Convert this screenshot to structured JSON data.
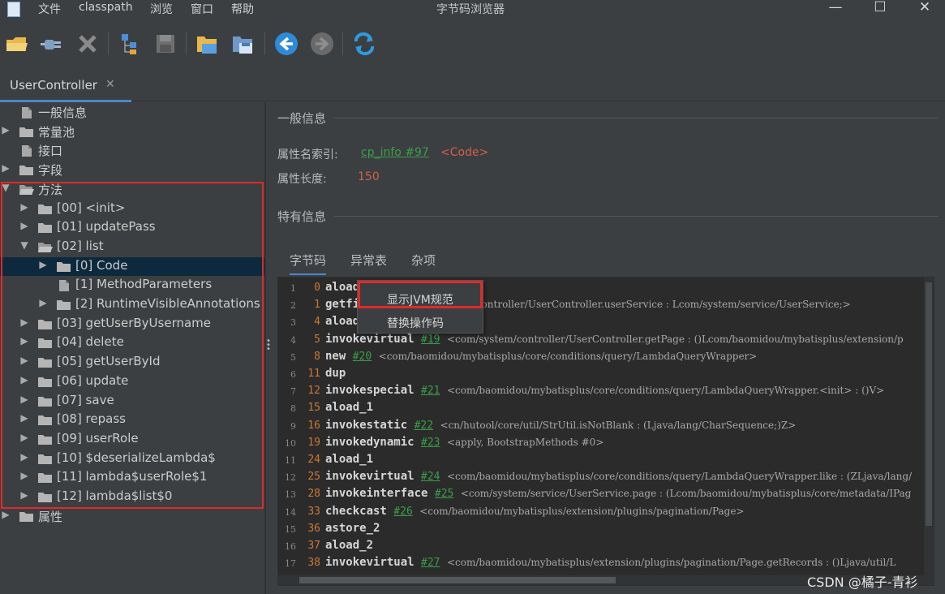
{
  "menu": [
    "文件",
    "classpath",
    "浏览",
    "窗口",
    "帮助"
  ],
  "window_title": "字节码浏览器",
  "window_controls": [
    "minimize-icon",
    "maximize-icon",
    "close-icon"
  ],
  "toolbar_icons": [
    "open-folder-icon",
    "plug-icon",
    "close-x-icon",
    "tree-icon",
    "save-icon",
    "folder-open-icon",
    "save-as-icon",
    "back-arrow-icon",
    "forward-arrow-icon",
    "refresh-icon"
  ],
  "tab": {
    "label": "UserController",
    "close": "✕"
  },
  "tree": [
    {
      "label": "一般信息",
      "arrow": "",
      "icon": "file"
    },
    {
      "label": "常量池",
      "arrow": "▶",
      "icon": "folder"
    },
    {
      "label": "接口",
      "arrow": "",
      "icon": "file"
    },
    {
      "label": "字段",
      "arrow": "▶",
      "icon": "folder"
    },
    {
      "label": "方法",
      "arrow": "▼",
      "icon": "folder-open"
    },
    {
      "label": "[00] <init>",
      "arrow": "▶",
      "icon": "folder"
    },
    {
      "label": "[01] updatePass",
      "arrow": "▶",
      "icon": "folder"
    },
    {
      "label": "[02] list",
      "arrow": "▼",
      "icon": "folder-open"
    },
    {
      "label": "[0] Code",
      "arrow": "▶",
      "icon": "folder"
    },
    {
      "label": "[1] MethodParameters",
      "arrow": "",
      "icon": "file"
    },
    {
      "label": "[2] RuntimeVisibleAnnotations",
      "arrow": "▶",
      "icon": "folder"
    },
    {
      "label": "[03] getUserByUsername",
      "arrow": "▶",
      "icon": "folder"
    },
    {
      "label": "[04] delete",
      "arrow": "▶",
      "icon": "folder"
    },
    {
      "label": "[05] getUserById",
      "arrow": "▶",
      "icon": "folder"
    },
    {
      "label": "[06] update",
      "arrow": "▶",
      "icon": "folder"
    },
    {
      "label": "[07] save",
      "arrow": "▶",
      "icon": "folder"
    },
    {
      "label": "[08] repass",
      "arrow": "▶",
      "icon": "folder"
    },
    {
      "label": "[09] userRole",
      "arrow": "▶",
      "icon": "folder"
    },
    {
      "label": "[10] $deserializeLambda$",
      "arrow": "▶",
      "icon": "folder"
    },
    {
      "label": "[11] lambda$userRole$1",
      "arrow": "▶",
      "icon": "folder"
    },
    {
      "label": "[12] lambda$list$0",
      "arrow": "▶",
      "icon": "folder"
    },
    {
      "label": "属性",
      "arrow": "▶",
      "icon": "folder"
    }
  ],
  "general": {
    "title": "一般信息",
    "attr_name_label": "属性名索引:",
    "attr_name_link": "cp_info #97",
    "attr_name_value": "<Code>",
    "attr_len_label": "属性长度:",
    "attr_len_value": "150"
  },
  "specific": {
    "title": "特有信息"
  },
  "subtabs": [
    "字节码",
    "异常表",
    "杂项"
  ],
  "code_lines": [
    {
      "n": "1",
      "off": "0",
      "op": "aload_0",
      "ref": "",
      "cmt": ""
    },
    {
      "n": "2",
      "off": "1",
      "op": "getfield",
      "ref": "#2",
      "cmt": "<com/system/controller/UserController.userService : Lcom/system/service/UserService;>"
    },
    {
      "n": "3",
      "off": "4",
      "op": "aload_1",
      "ref": "",
      "cmt": ""
    },
    {
      "n": "4",
      "off": "5",
      "op": "invokevirtual",
      "ref": "#19",
      "cmt": "<com/system/controller/UserController.getPage : ()Lcom/baomidou/mybatisplus/extension/p"
    },
    {
      "n": "5",
      "off": "8",
      "op": "new",
      "ref": "#20",
      "cmt": "<com/baomidou/mybatisplus/core/conditions/query/LambdaQueryWrapper>"
    },
    {
      "n": "6",
      "off": "11",
      "op": "dup",
      "ref": "",
      "cmt": ""
    },
    {
      "n": "7",
      "off": "12",
      "op": "invokespecial",
      "ref": "#21",
      "cmt": "<com/baomidou/mybatisplus/core/conditions/query/LambdaQueryWrapper.<init> : ()V>"
    },
    {
      "n": "8",
      "off": "15",
      "op": "aload_1",
      "ref": "",
      "cmt": ""
    },
    {
      "n": "9",
      "off": "16",
      "op": "invokestatic",
      "ref": "#22",
      "cmt": "<cn/hutool/core/util/StrUtil.isNotBlank : (Ljava/lang/CharSequence;)Z>"
    },
    {
      "n": "10",
      "off": "19",
      "op": "invokedynamic",
      "ref": "#23",
      "cmt": "<apply, BootstrapMethods #0>"
    },
    {
      "n": "11",
      "off": "24",
      "op": "aload_1",
      "ref": "",
      "cmt": ""
    },
    {
      "n": "12",
      "off": "25",
      "op": "invokevirtual",
      "ref": "#24",
      "cmt": "<com/baomidou/mybatisplus/core/conditions/query/LambdaQueryWrapper.like : (ZLjava/lang/"
    },
    {
      "n": "13",
      "off": "28",
      "op": "invokeinterface",
      "ref": "#25",
      "cmt": "<com/system/service/UserService.page : (Lcom/baomidou/mybatisplus/core/metadata/IPag"
    },
    {
      "n": "14",
      "off": "33",
      "op": "checkcast",
      "ref": "#26",
      "cmt": "<com/baomidou/mybatisplus/extension/plugins/pagination/Page>"
    },
    {
      "n": "15",
      "off": "36",
      "op": "astore_2",
      "ref": "",
      "cmt": ""
    },
    {
      "n": "16",
      "off": "37",
      "op": "aload_2",
      "ref": "",
      "cmt": ""
    },
    {
      "n": "17",
      "off": "38",
      "op": "invokevirtual",
      "ref": "#27",
      "cmt": "<com/baomidou/mybatisplus/extension/plugins/pagination/Page.getRecords : ()Ljava/util/L"
    }
  ],
  "context_menu": [
    "显示JVM规范",
    "替换操作码"
  ],
  "watermark": "CSDN @橘子-青衫"
}
